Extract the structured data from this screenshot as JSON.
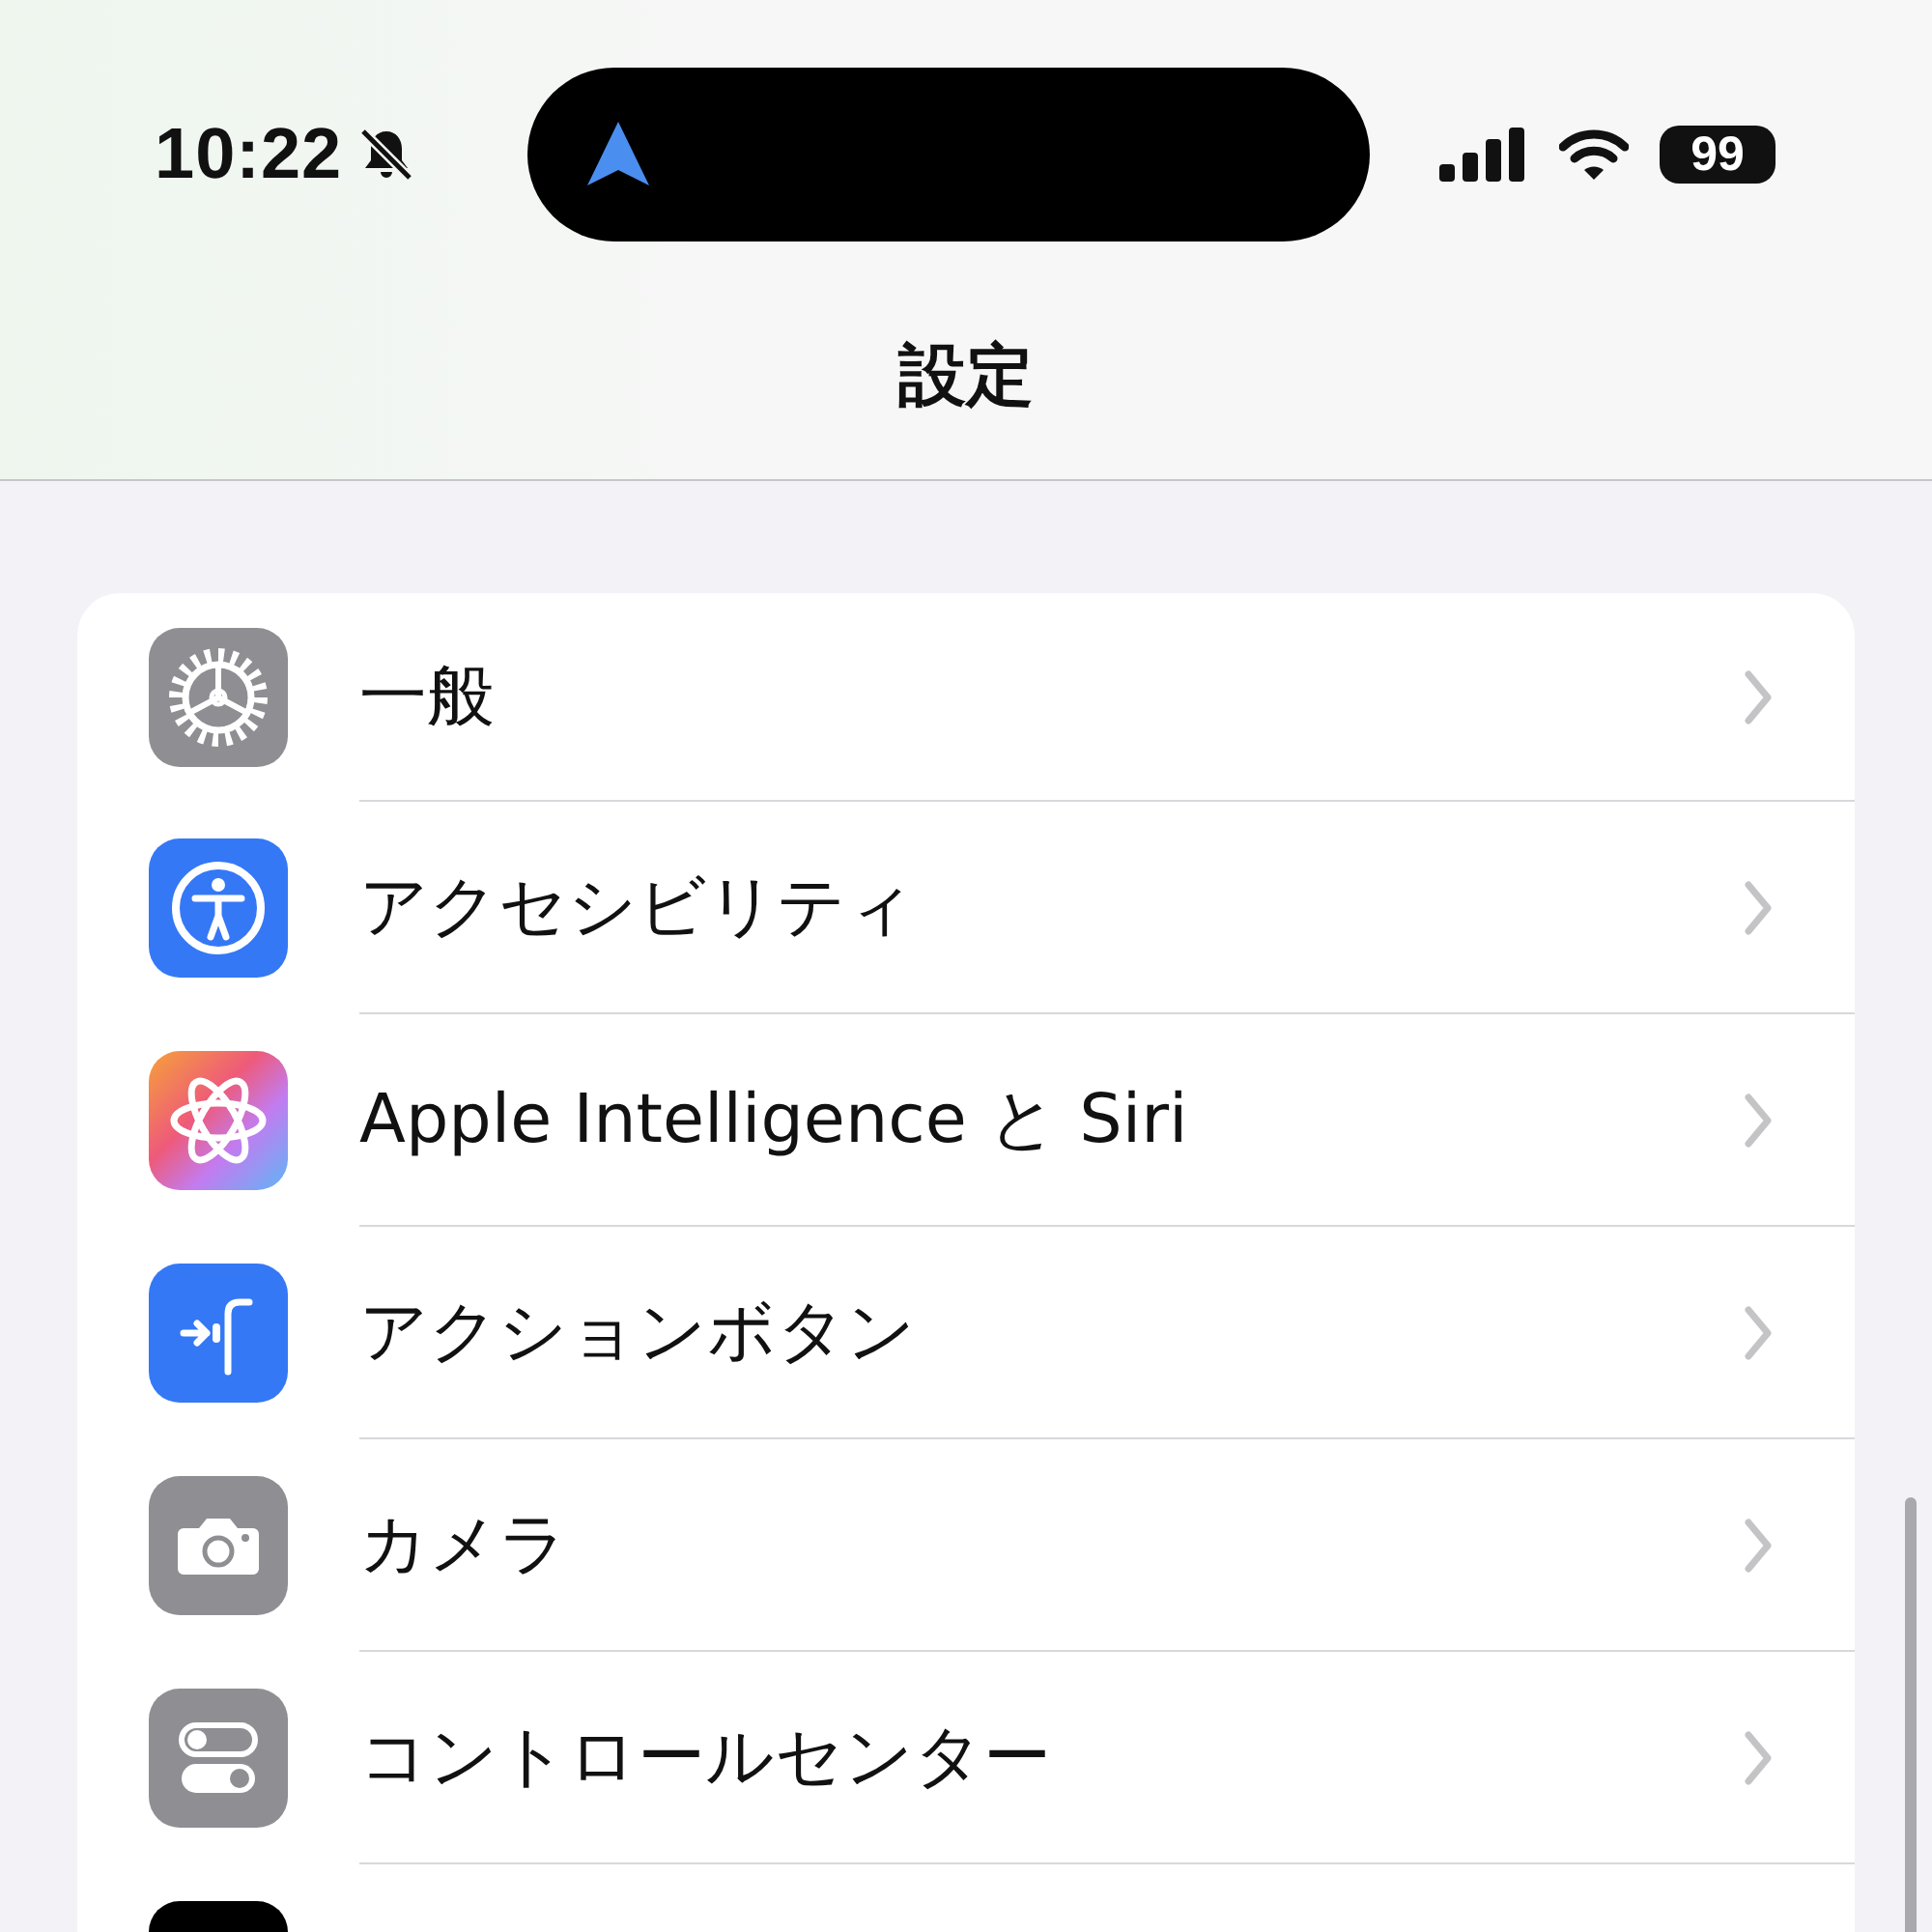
{
  "status_bar": {
    "time": "10:22",
    "battery": "99"
  },
  "navigation": {
    "title": "設定"
  },
  "settings": [
    {
      "kind": "gear",
      "label": "一般"
    },
    {
      "kind": "accessibility",
      "label": "アクセシビリティ"
    },
    {
      "kind": "intelligence",
      "label": "Apple Intelligence と Siri"
    },
    {
      "kind": "action",
      "label": "アクションボタン"
    },
    {
      "kind": "camera",
      "label": "カメラ"
    },
    {
      "kind": "controls",
      "label": "コントロールセンター"
    },
    {
      "kind": "dark"
    }
  ]
}
